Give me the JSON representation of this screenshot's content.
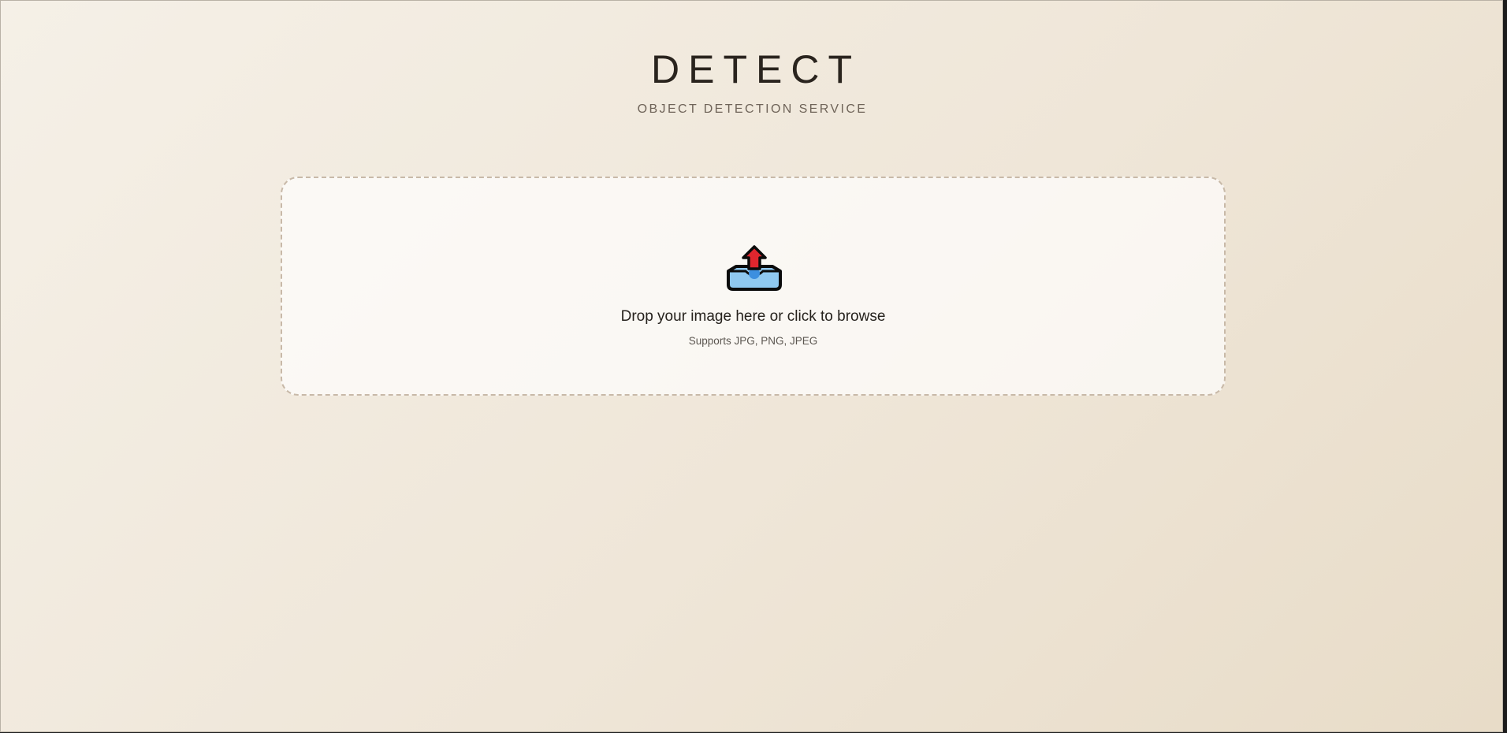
{
  "header": {
    "title": "DETECT",
    "subtitle": "OBJECT DETECTION SERVICE"
  },
  "upload": {
    "icon": "inbox-upload-icon",
    "prompt": "Drop your image here or click to browse",
    "supported_formats": "Supports JPG, PNG, JPEG"
  },
  "colors": {
    "background_start": "#f5f0e7",
    "background_end": "#e8dcc8",
    "title": "#2a241e",
    "dropzone_border": "#c8b9a8",
    "icon_tray": "#8fc8f0",
    "icon_arrow": "#e0262e"
  }
}
